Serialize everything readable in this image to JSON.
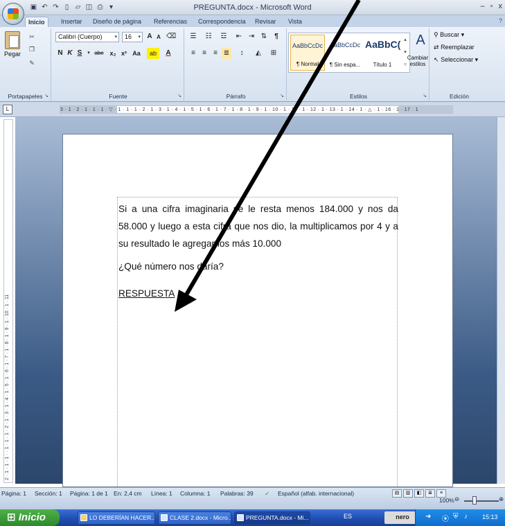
{
  "window": {
    "title": "PREGUNTA.docx - Microsoft Word",
    "controls": {
      "minimize": "–",
      "restore": "▫",
      "close": "x"
    }
  },
  "tabs": [
    {
      "label": "Inicio",
      "active": true
    },
    {
      "label": "Insertar"
    },
    {
      "label": "Diseño de página"
    },
    {
      "label": "Referencias"
    },
    {
      "label": "Correspondencia"
    },
    {
      "label": "Revisar"
    },
    {
      "label": "Vista"
    }
  ],
  "ribbon": {
    "clipboard": {
      "paste_label": "Pegar",
      "group_label": "Portapapeles"
    },
    "font": {
      "font_name": "Calibri (Cuerpo)",
      "font_size": "16",
      "bold": "N",
      "italic": "K",
      "underline": "S",
      "strike": "abe",
      "subscript": "x₂",
      "superscript": "x²",
      "change_case": "Aa",
      "grow_font": "A",
      "shrink_font": "A",
      "highlight": "ab",
      "font_color": "A",
      "group_label": "Fuente"
    },
    "paragraph": {
      "group_label": "Párrafo"
    },
    "styles": {
      "items": [
        {
          "preview": "AaBbCcDc",
          "name": "¶ Normal",
          "selected": true
        },
        {
          "preview": "AaBbCcDc",
          "name": "¶ Sin espa..."
        },
        {
          "preview": "AaBbC(",
          "name": "Título 1"
        }
      ],
      "change_styles": "Cambiar estilos",
      "group_label": "Estilos"
    },
    "editing": {
      "find": "Buscar",
      "replace": "Reemplazar",
      "select": "Seleccionar",
      "group_label": "Edición"
    }
  },
  "ruler": {
    "horizontal": "3 · 1 · 2 · 1 · 1 · 1 · ▽ · 1 · 1 · 1 · 2 · 1 · 3 · 1 · 4 · 1 · 5 · 1 · 6 · 1 · 7 · 1 · 8 · 1 · 9 · 1 · 10 · 1 · 11 · 1 · 12 · 1 · 13 · 1 · 14 · 1 · △ · 1 · 16 · 1 · 17 · 1",
    "vertical": "2 · 1 · 1 · 1 · · 1 · 1 · 1 · 2 · 1 · 3 · 1 · 4 · 1 · 5 · 1 · 6 · 1 · 7 · 1 · 8 · 1 · 9 · 1 · 10 · 1 · 11"
  },
  "document": {
    "paragraph_1": "Si a una cifra imaginaria se le resta menos 184.000 y nos da 58.000 y luego a esta cifra que nos dio, la multiplicamos por 4 y a su resultado le agregamos más 10.000",
    "question": "¿Qué número nos daría?",
    "answer_label": "RESPUESTA"
  },
  "statusbar": {
    "page": "Página: 1",
    "section": "Sección: 1",
    "page_of": "Página: 1 de 1",
    "position": "En: 2,4 cm",
    "line": "Línea: 1",
    "column": "Columna: 1",
    "words": "Palabras: 39",
    "language": "Español (alfab. internacional)",
    "zoom": "100%"
  },
  "taskbar": {
    "start": "Inicio",
    "items": [
      {
        "label": "LO DEBERÍAN HACER..."
      },
      {
        "label": "CLASE 2.docx - Micro..."
      },
      {
        "label": "PREGUNTA.docx - Mi...",
        "active": true
      }
    ],
    "language": "ES",
    "nero": "nero",
    "clock": "15:13"
  }
}
